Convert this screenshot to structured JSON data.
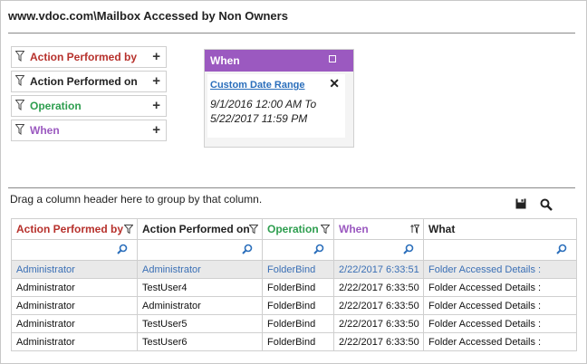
{
  "page_title": "www.vdoc.com\\Mailbox Accessed by Non Owners",
  "colors": {
    "action_by": "#b7312c",
    "action_on": "#222222",
    "operation": "#2e9e4f",
    "when": "#9b59c0",
    "what": "#222222",
    "link": "#2a6ebb"
  },
  "filters": [
    {
      "label": "Action Performed by",
      "icon": "funnel-icon",
      "action_icon": "plus-icon"
    },
    {
      "label": "Action Performed on",
      "icon": "funnel-icon",
      "action_icon": "plus-icon"
    },
    {
      "label": "Operation",
      "icon": "funnel-icon",
      "action_icon": "plus-icon"
    },
    {
      "label": "When",
      "icon": "funnel-icon",
      "action_icon": "plus-icon"
    }
  ],
  "when_panel": {
    "title": "When",
    "link": "Custom Date Range",
    "range_line1": "9/1/2016 12:00 AM To",
    "range_line2": "5/22/2017 11:59 PM"
  },
  "grid": {
    "group_hint": "Drag a column header here to group by that column.",
    "columns": [
      "Action Performed by",
      "Action Performed on",
      "Operation",
      "When",
      "What"
    ],
    "rows": [
      [
        "Administrator",
        "Administrator",
        "FolderBind",
        "2/22/2017 6:33:51",
        "Folder Accessed Details :"
      ],
      [
        "Administrator",
        "TestUser4",
        "FolderBind",
        "2/22/2017 6:33:50",
        "Folder Accessed Details :"
      ],
      [
        "Administrator",
        "Administrator",
        "FolderBind",
        "2/22/2017 6:33:50",
        "Folder Accessed Details :"
      ],
      [
        "Administrator",
        "TestUser5",
        "FolderBind",
        "2/22/2017 6:33:50",
        "Folder Accessed Details :"
      ],
      [
        "Administrator",
        "TestUser6",
        "FolderBind",
        "2/22/2017 6:33:50",
        "Folder Accessed Details :"
      ]
    ]
  }
}
